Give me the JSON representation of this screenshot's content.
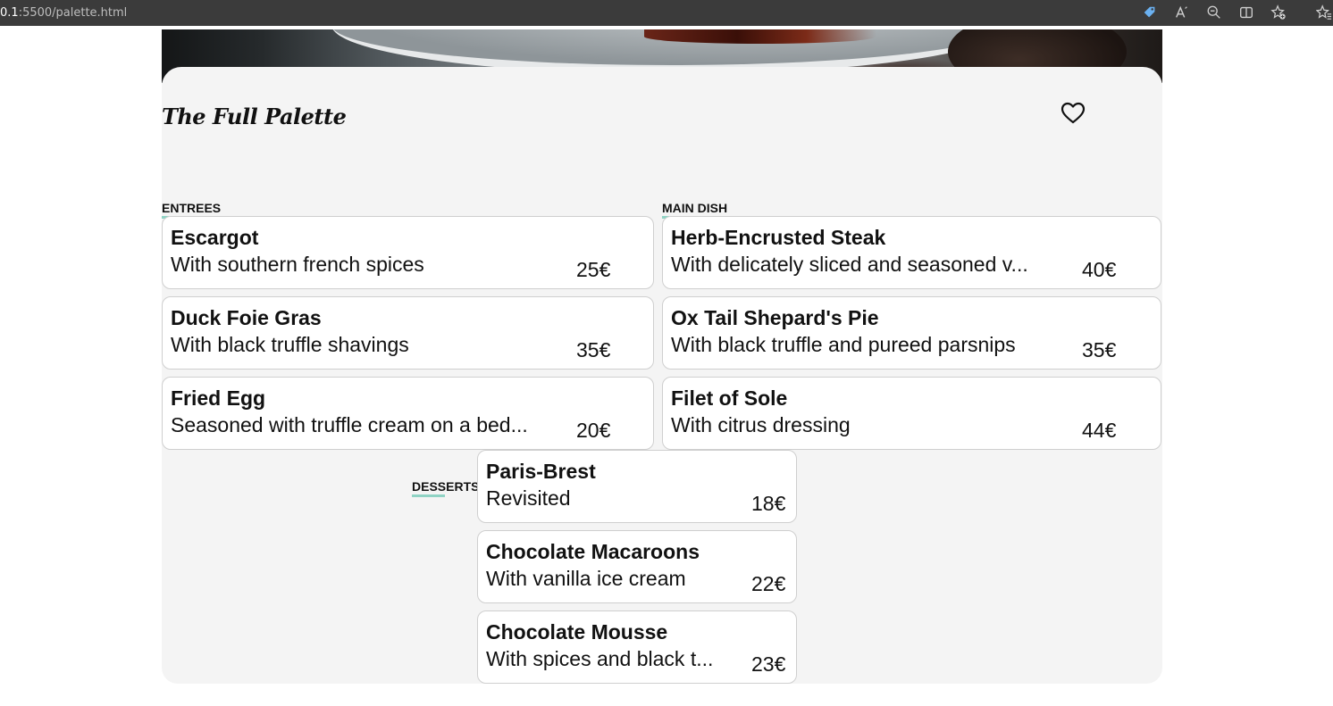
{
  "browser": {
    "url_host": "0.1",
    "url_path": ":5500/palette.html"
  },
  "brand": {
    "title": "The Full Palette"
  },
  "sections": {
    "entrees": {
      "label": "ENTREES",
      "items": [
        {
          "name": "Escargot",
          "desc": "With southern french spices",
          "price": "25€"
        },
        {
          "name": "Duck Foie Gras",
          "desc": "With black truffle shavings",
          "price": "35€"
        },
        {
          "name": "Fried Egg",
          "desc": "Seasoned with truffle cream on a bed...",
          "price": "20€"
        }
      ]
    },
    "main": {
      "label": "MAIN DISH",
      "items": [
        {
          "name": "Herb-Encrusted Steak",
          "desc": "With delicately sliced and seasoned v...",
          "price": "40€"
        },
        {
          "name": "Ox Tail Shepard's Pie",
          "desc": "With black truffle and pureed parsnips",
          "price": "35€"
        },
        {
          "name": "Filet of Sole",
          "desc": "With citrus dressing",
          "price": "44€"
        }
      ]
    },
    "desserts": {
      "label": "DESSERTS",
      "items": [
        {
          "name": "Paris-Brest",
          "desc": "Revisited",
          "price": "18€"
        },
        {
          "name": "Chocolate Macaroons",
          "desc": "With vanilla ice cream",
          "price": "22€"
        },
        {
          "name": "Chocolate Mousse",
          "desc": "With spices and black t...",
          "price": "23€"
        }
      ]
    }
  },
  "colors": {
    "accent": "#8fd3c4",
    "panel_bg": "#f4f4f4",
    "browser_bar": "#3b3b3b"
  },
  "icons": [
    "tag-icon",
    "read-aloud-icon",
    "zoom-out-icon",
    "split-screen-icon",
    "add-favorite-icon",
    "favorites-icon",
    "heart-icon"
  ]
}
